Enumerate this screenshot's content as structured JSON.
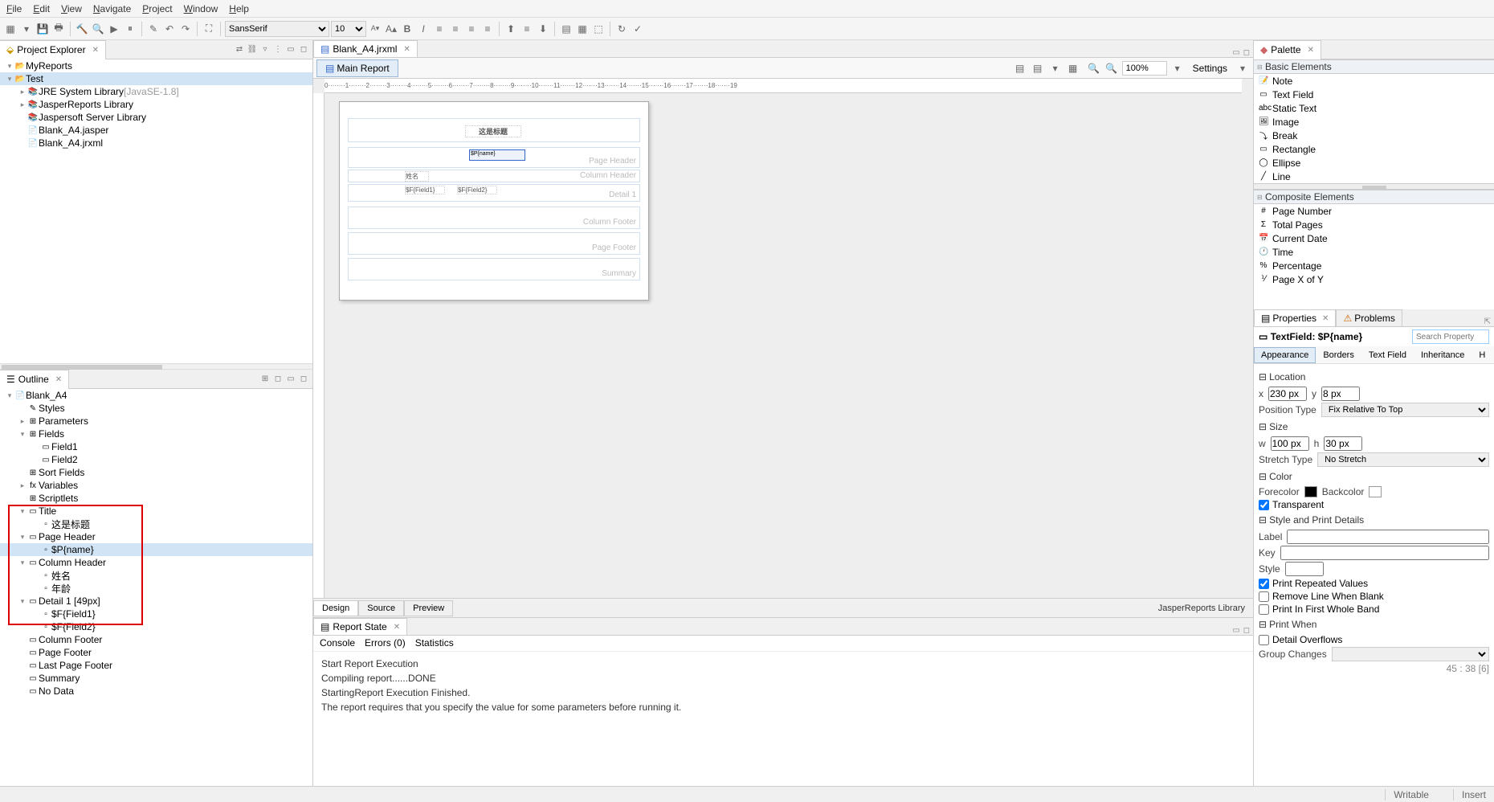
{
  "menu": [
    "File",
    "Edit",
    "View",
    "Navigate",
    "Project",
    "Window",
    "Help"
  ],
  "toolbar": {
    "font": "SansSerif",
    "size": "10",
    "btns": [
      "▦",
      "◩",
      "💾",
      "🖶",
      "🔨",
      "🔍",
      "▶",
      "⏸",
      "⋯",
      "✎",
      "↶",
      "↷",
      "✂",
      "📋",
      "📄",
      "|",
      "⛶",
      "SansSerif",
      "10",
      "▾",
      "A",
      "A",
      "B",
      "I",
      "≡",
      "≡",
      "≡",
      "≡",
      "|",
      "≣",
      "≡",
      "≡",
      "|",
      "▤",
      "▦",
      "⬚",
      "|",
      "↻",
      "✓"
    ]
  },
  "explorer": {
    "title": "Project Explorer",
    "items": [
      {
        "ind": 0,
        "exp": "▾",
        "icon": "📂",
        "c": "gold",
        "t": "MyReports"
      },
      {
        "ind": 0,
        "exp": "▾",
        "icon": "📂",
        "c": "gold",
        "t": "Test",
        "sel": true
      },
      {
        "ind": 1,
        "exp": "▸",
        "icon": "📚",
        "c": "",
        "t": "JRE System Library ",
        "extra": "[JavaSE-1.8]"
      },
      {
        "ind": 1,
        "exp": "▸",
        "icon": "📚",
        "c": "",
        "t": "JasperReports Library"
      },
      {
        "ind": 1,
        "exp": "",
        "icon": "📚",
        "c": "",
        "t": "Jaspersoft Server Library"
      },
      {
        "ind": 1,
        "exp": "",
        "icon": "📄",
        "c": "blue",
        "t": "Blank_A4.jasper"
      },
      {
        "ind": 1,
        "exp": "",
        "icon": "📄",
        "c": "blue",
        "t": "Blank_A4.jrxml"
      }
    ]
  },
  "outline": {
    "title": "Outline",
    "items": [
      {
        "ind": 0,
        "exp": "▾",
        "icon": "📄",
        "t": "Blank_A4"
      },
      {
        "ind": 1,
        "exp": "",
        "icon": "✎",
        "t": "Styles"
      },
      {
        "ind": 1,
        "exp": "▸",
        "icon": "⊞",
        "t": "Parameters"
      },
      {
        "ind": 1,
        "exp": "▾",
        "icon": "⊞",
        "t": "Fields"
      },
      {
        "ind": 2,
        "exp": "",
        "icon": "▭",
        "t": "Field1"
      },
      {
        "ind": 2,
        "exp": "",
        "icon": "▭",
        "t": "Field2"
      },
      {
        "ind": 1,
        "exp": "",
        "icon": "⊞",
        "t": "Sort Fields"
      },
      {
        "ind": 1,
        "exp": "▸",
        "icon": "fx",
        "t": "Variables"
      },
      {
        "ind": 1,
        "exp": "",
        "icon": "⊞",
        "t": "Scriptlets"
      },
      {
        "ind": 1,
        "exp": "▾",
        "icon": "▭",
        "t": "Title"
      },
      {
        "ind": 2,
        "exp": "",
        "icon": "▫",
        "t": "这是标题"
      },
      {
        "ind": 1,
        "exp": "▾",
        "icon": "▭",
        "t": "Page Header"
      },
      {
        "ind": 2,
        "exp": "",
        "icon": "▫",
        "t": "$P{name}",
        "sel": true
      },
      {
        "ind": 1,
        "exp": "▾",
        "icon": "▭",
        "t": "Column Header"
      },
      {
        "ind": 2,
        "exp": "",
        "icon": "▫",
        "t": "姓名"
      },
      {
        "ind": 2,
        "exp": "",
        "icon": "▫",
        "t": "年龄"
      },
      {
        "ind": 1,
        "exp": "▾",
        "icon": "▭",
        "t": "Detail 1 [49px]"
      },
      {
        "ind": 2,
        "exp": "",
        "icon": "▫",
        "t": "$F{Field1}"
      },
      {
        "ind": 2,
        "exp": "",
        "icon": "▫",
        "t": "$F{Field2}"
      },
      {
        "ind": 1,
        "exp": "",
        "icon": "▭",
        "t": "Column Footer"
      },
      {
        "ind": 1,
        "exp": "",
        "icon": "▭",
        "t": "Page Footer"
      },
      {
        "ind": 1,
        "exp": "",
        "icon": "▭",
        "t": "Last Page Footer"
      },
      {
        "ind": 1,
        "exp": "",
        "icon": "▭",
        "t": "Summary"
      },
      {
        "ind": 1,
        "exp": "",
        "icon": "▭",
        "t": "No Data"
      }
    ]
  },
  "editor": {
    "tab": "Blank_A4.jrxml",
    "subtab": "Main Report",
    "zoom": "100%",
    "settings": "Settings",
    "ruler": "0········1········2········3········4········5········6········7········8········9········10·······11·······12·······13·······14·······15·······16·······17·······18·······19",
    "bands": {
      "ph": "Page Header",
      "ch": "Column Header",
      "d1": "Detail 1",
      "cf": "Column Footer",
      "pf": "Page Footer",
      "sm": "Summary"
    },
    "title_text": "这是标题",
    "sel_text": "$P{name}",
    "f1": "姓名",
    "f2": "$F{Field1}",
    "f3": "$F{Field2}",
    "tabs": [
      "Design",
      "Source",
      "Preview"
    ],
    "attr": "JasperReports Library"
  },
  "reportState": {
    "title": "Report State",
    "tabs": [
      "Console",
      "Errors (0)",
      "Statistics"
    ],
    "lines": [
      "Start Report Execution",
      "Compiling report......DONE",
      "StartingReport Execution Finished.",
      "The report requires that you specify the value for some parameters before running it."
    ]
  },
  "palette": {
    "title": "Palette",
    "basic": {
      "h": "Basic Elements",
      "items": [
        [
          "📝",
          "Note"
        ],
        [
          "▭",
          "Text Field"
        ],
        [
          "abc",
          "Static Text"
        ],
        [
          "🖼",
          "Image"
        ],
        [
          "⤵",
          "Break"
        ],
        [
          "▭",
          "Rectangle"
        ],
        [
          "◯",
          "Ellipse"
        ],
        [
          "╱",
          "Line"
        ]
      ]
    },
    "composite": {
      "h": "Composite Elements",
      "items": [
        [
          "#",
          "Page Number"
        ],
        [
          "Σ",
          "Total Pages"
        ],
        [
          "📅",
          "Current Date"
        ],
        [
          "🕐",
          "Time"
        ],
        [
          "%",
          "Percentage"
        ],
        [
          "⅟",
          "Page X of Y"
        ]
      ]
    }
  },
  "props": {
    "tabs": [
      "Properties",
      "Problems"
    ],
    "title": "TextField: $P{name}",
    "search": "Search Property",
    "subtabs": [
      "Appearance",
      "Borders",
      "Text Field",
      "Inheritance",
      "H"
    ],
    "loc": {
      "h": "Location",
      "x": "230 px",
      "y": "8 px",
      "ptl": "Position Type",
      "pt": "Fix Relative To Top"
    },
    "size": {
      "h": "Size",
      "w": "100 px",
      "hh": "30 px",
      "stl": "Stretch Type",
      "st": "No Stretch"
    },
    "color": {
      "h": "Color",
      "fore": "Forecolor",
      "back": "Backcolor",
      "transp": "Transparent"
    },
    "style": {
      "h": "Style and Print Details",
      "label": "Label",
      "key": "Key",
      "sty": "Style",
      "prv": "Print Repeated Values",
      "rm": "Remove Line When Blank",
      "pfw": "Print In First Whole Band"
    },
    "pw": {
      "h": "Print When",
      "dov": "Detail Overflows",
      "gc": "Group Changes"
    },
    "coord": "45 : 38 [6]"
  },
  "status": {
    "writable": "Writable",
    "insert": "Insert"
  }
}
